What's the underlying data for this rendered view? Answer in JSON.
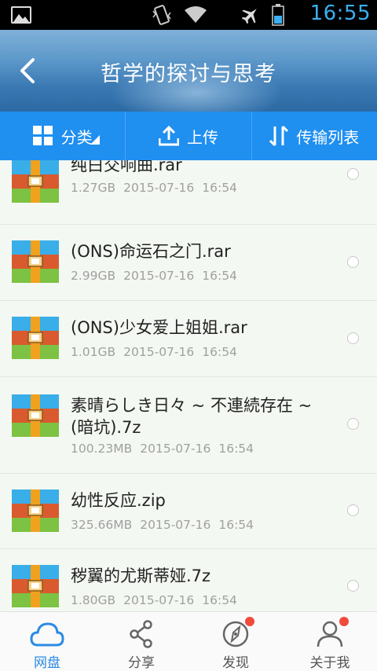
{
  "status_bar": {
    "time": "16:55",
    "icons": [
      "gallery-icon",
      "vibrate-icon",
      "wifi-icon",
      "airplane-mode-icon",
      "battery-icon"
    ]
  },
  "header": {
    "title": "哲学的探讨与思考",
    "back_icon": "chevron-left-icon"
  },
  "toolbar": {
    "category_label": "分类",
    "upload_label": "上传",
    "transfer_label": "传输列表"
  },
  "files": [
    {
      "name": "纯白交响曲.rar",
      "size": "1.27GB",
      "date": "2015-07-16",
      "time": "16:54",
      "icon": "archive-icon"
    },
    {
      "name": "(ONS)命运石之门.rar",
      "size": "2.99GB",
      "date": "2015-07-16",
      "time": "16:54",
      "icon": "archive-icon"
    },
    {
      "name": "(ONS)少女爱上姐姐.rar",
      "size": "1.01GB",
      "date": "2015-07-16",
      "time": "16:54",
      "icon": "archive-icon"
    },
    {
      "name": "素晴らしき日々 ~ 不連続存在 ~ (暗坑).7z",
      "size": "100.23MB",
      "date": "2015-07-16",
      "time": "16:54",
      "icon": "archive-icon"
    },
    {
      "name": "幼性反应.zip",
      "size": "325.66MB",
      "date": "2015-07-16",
      "time": "16:54",
      "icon": "archive-icon"
    },
    {
      "name": "秽翼的尤斯蒂娅.7z",
      "size": "1.80GB",
      "date": "2015-07-16",
      "time": "16:54",
      "icon": "archive-icon"
    }
  ],
  "bottom_nav": {
    "items": [
      {
        "label": "网盘",
        "icon": "cloud-icon",
        "active": true,
        "badge": false
      },
      {
        "label": "分享",
        "icon": "share-icon",
        "active": false,
        "badge": false
      },
      {
        "label": "发现",
        "icon": "compass-icon",
        "active": false,
        "badge": true
      },
      {
        "label": "关于我",
        "icon": "user-icon",
        "active": false,
        "badge": true
      }
    ]
  },
  "colors": {
    "accent": "#1f8ff0",
    "active_nav": "#2a8be2",
    "badge": "#f04a3c",
    "clock": "#3ab0f0"
  }
}
